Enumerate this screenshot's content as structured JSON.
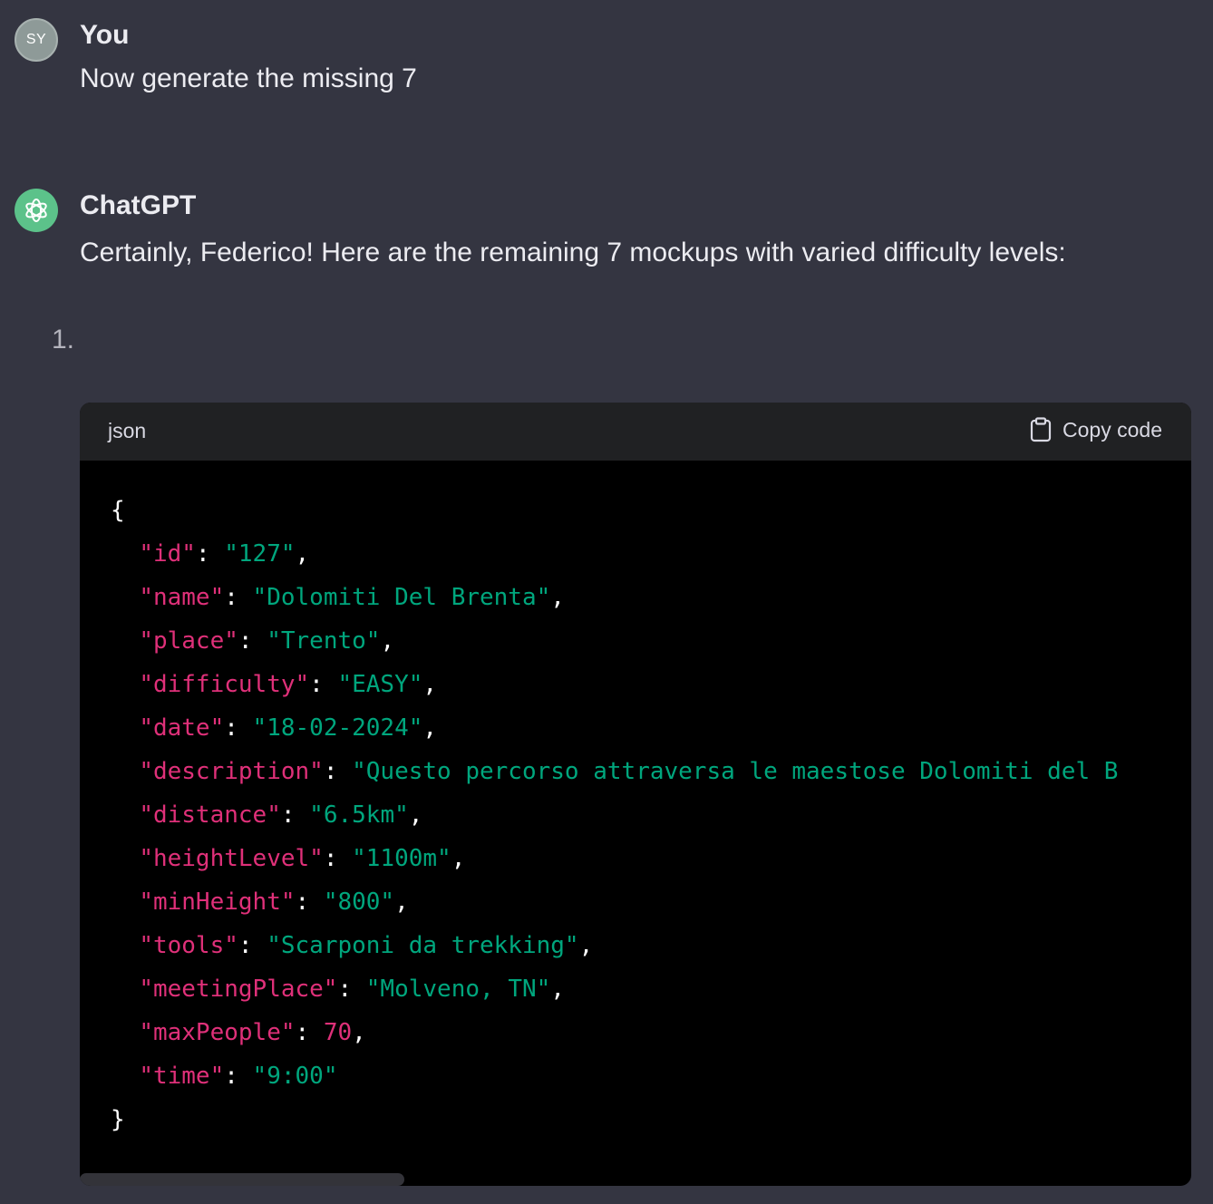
{
  "user_message": {
    "avatar_initials": "SY",
    "author": "You",
    "text": "Now generate the missing 7"
  },
  "assistant_message": {
    "avatar_icon": "openai-logo-icon",
    "author": "ChatGPT",
    "text": "Certainly, Federico! Here are the remaining 7 mockups with varied difficulty levels:",
    "list_number": "1."
  },
  "code_block": {
    "language": "json",
    "copy_label": "Copy code",
    "copy_icon": "clipboard-icon",
    "open_brace": "{",
    "close_brace": "}",
    "lines": [
      {
        "key": "\"id\"",
        "value": "\"127\"",
        "type": "s",
        "trail": ","
      },
      {
        "key": "\"name\"",
        "value": "\"Dolomiti Del Brenta\"",
        "type": "s",
        "trail": ","
      },
      {
        "key": "\"place\"",
        "value": "\"Trento\"",
        "type": "s",
        "trail": ","
      },
      {
        "key": "\"difficulty\"",
        "value": "\"EASY\"",
        "type": "s",
        "trail": ","
      },
      {
        "key": "\"date\"",
        "value": "\"18-02-2024\"",
        "type": "s",
        "trail": ","
      },
      {
        "key": "\"description\"",
        "value": "\"Questo percorso attraversa le maestose Dolomiti del B",
        "type": "s",
        "trail": ""
      },
      {
        "key": "\"distance\"",
        "value": "\"6.5km\"",
        "type": "s",
        "trail": ","
      },
      {
        "key": "\"heightLevel\"",
        "value": "\"1100m\"",
        "type": "s",
        "trail": ","
      },
      {
        "key": "\"minHeight\"",
        "value": "\"800\"",
        "type": "s",
        "trail": ","
      },
      {
        "key": "\"tools\"",
        "value": "\"Scarponi da trekking\"",
        "type": "s",
        "trail": ","
      },
      {
        "key": "\"meetingPlace\"",
        "value": "\"Molveno, TN\"",
        "type": "s",
        "trail": ","
      },
      {
        "key": "\"maxPeople\"",
        "value": "70",
        "type": "n",
        "trail": ","
      },
      {
        "key": "\"time\"",
        "value": "\"9:00\"",
        "type": "s",
        "trail": ""
      }
    ]
  },
  "colors": {
    "background": "#343541",
    "code_bg": "#000000",
    "code_header_bg": "#202123",
    "key_color": "#df3079",
    "string_color": "#00a67d",
    "assistant_avatar": "#5cc28a"
  }
}
